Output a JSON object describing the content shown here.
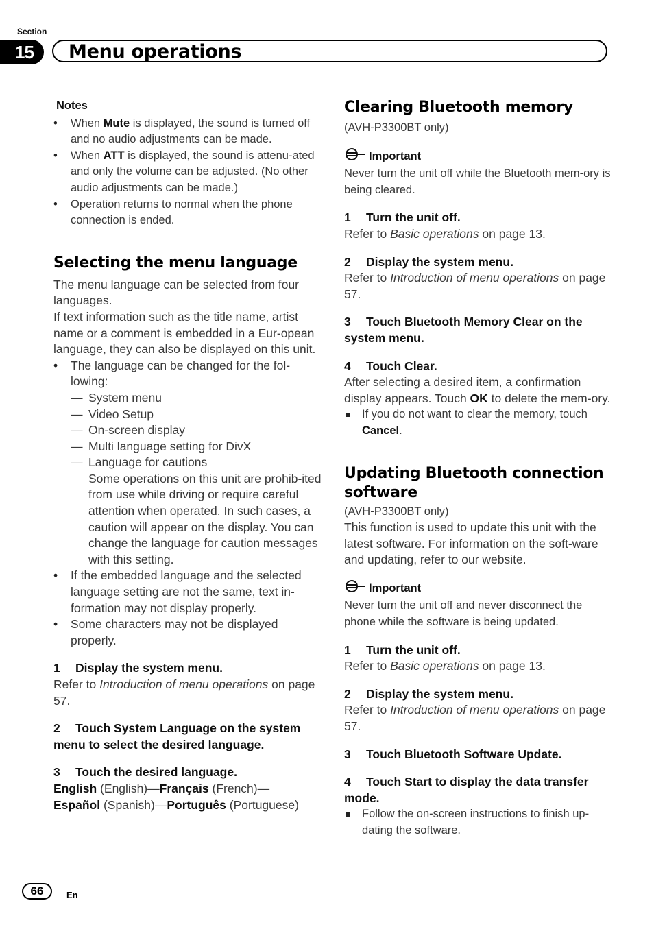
{
  "header": {
    "section_label": "Section",
    "section_number": "15",
    "title": "Menu operations"
  },
  "left": {
    "notes_title": "Notes",
    "notes": [
      {
        "pre": "When ",
        "bold": "Mute",
        "post": " is displayed, the sound is turned off and no audio adjustments can be made."
      },
      {
        "pre": "When ",
        "bold": "ATT",
        "post": " is displayed, the sound is attenu-ated and only the volume can be adjusted. (No other audio adjustments can be made.)"
      },
      {
        "pre": "Operation returns to normal when the phone connection is ended.",
        "bold": "",
        "post": ""
      }
    ],
    "heading": "Selecting the menu language",
    "intro_1": "The menu language can be selected from four languages.",
    "intro_2": "If text information such as the title name, artist name or a comment is embedded in a Eur-opean language, they can also be displayed on this unit.",
    "bullet_1": "The language can be changed for the fol-lowing:",
    "dash_items": [
      "System menu",
      "Video Setup",
      "On-screen display",
      "Multi language setting for DivX",
      "Language for cautions"
    ],
    "caution_text": "Some operations on this unit are prohib-ited from use while driving or require careful attention when operated. In such cases, a caution will appear on the display. You can change the language for caution messages with this setting.",
    "bullet_2": "If the embedded language and the selected language setting are not the same, text in-formation may not display properly.",
    "bullet_3": "Some characters may not be displayed properly.",
    "steps": [
      {
        "num": "1",
        "title": "Display the system menu.",
        "ref_pre": "Refer to ",
        "ref_italic": "Introduction of menu operations",
        "ref_post": " on page 57."
      },
      {
        "num": "2",
        "title": "Touch System Language on the system menu to select the desired language."
      },
      {
        "num": "3",
        "title": "Touch the desired language."
      }
    ],
    "languages": [
      {
        "name": "English",
        "gloss": "(English)"
      },
      {
        "name": "Français",
        "gloss": "(French)"
      },
      {
        "name": "Español",
        "gloss": "(Spanish)"
      },
      {
        "name": "Português",
        "gloss": "(Portuguese)"
      }
    ]
  },
  "right": {
    "clear": {
      "heading": "Clearing Bluetooth memory",
      "model_note": "(AVH-P3300BT only)",
      "important_label": "Important",
      "important_text": "Never turn the unit off while the Bluetooth mem-ory is being cleared.",
      "steps": [
        {
          "num": "1",
          "title": "Turn the unit off.",
          "ref_pre": "Refer to ",
          "ref_italic": "Basic operations",
          "ref_post": " on page 13."
        },
        {
          "num": "2",
          "title": "Display the system menu.",
          "ref_pre": "Refer to ",
          "ref_italic": "Introduction of menu operations",
          "ref_post": " on page 57."
        },
        {
          "num": "3",
          "title": "Touch Bluetooth Memory Clear on the system menu."
        },
        {
          "num": "4",
          "title": "Touch Clear."
        }
      ],
      "after_pre": "After selecting a desired item, a confirmation display appears. Touch ",
      "after_bold": "OK",
      "after_post": " to delete the mem-ory.",
      "note_pre": "If you do not want to clear the memory, touch ",
      "note_bold": "Cancel",
      "note_post": "."
    },
    "update": {
      "heading": "Updating Bluetooth connection software",
      "model_note": "(AVH-P3300BT only)",
      "intro": "This function is used to update this unit with the latest software. For information on the soft-ware and updating, refer to our website.",
      "important_label": "Important",
      "important_text": "Never turn the unit off and never disconnect the phone while the software is being updated.",
      "steps": [
        {
          "num": "1",
          "title": "Turn the unit off.",
          "ref_pre": "Refer to ",
          "ref_italic": "Basic operations",
          "ref_post": " on page 13."
        },
        {
          "num": "2",
          "title": "Display the system menu.",
          "ref_pre": "Refer to ",
          "ref_italic": "Introduction of menu operations",
          "ref_post": " on page 57."
        },
        {
          "num": "3",
          "title": "Touch Bluetooth Software Update."
        },
        {
          "num": "4",
          "title": "Touch Start to display the data transfer mode."
        }
      ],
      "note": "Follow the on-screen instructions to finish up-dating the software."
    }
  },
  "footer": {
    "page_number": "66",
    "language": "En"
  }
}
